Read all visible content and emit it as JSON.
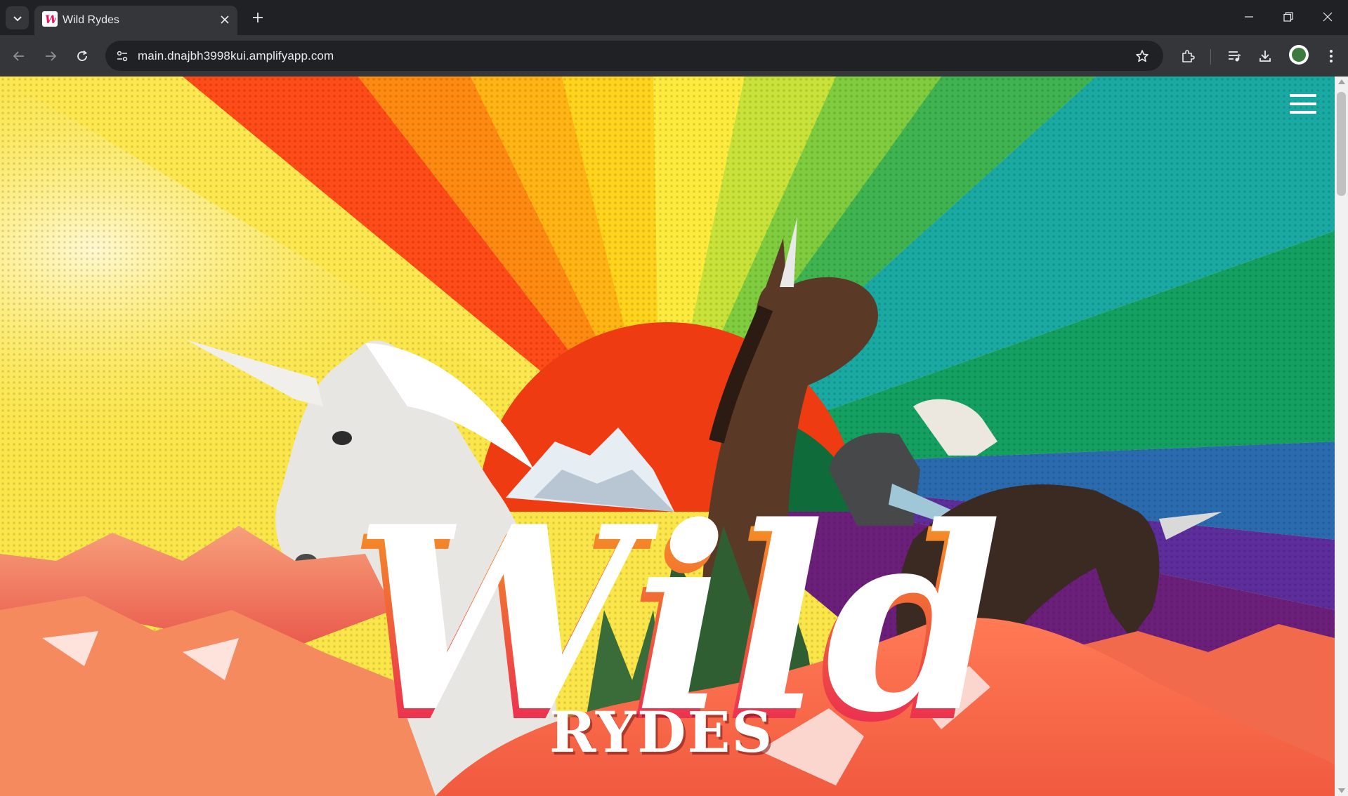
{
  "browser": {
    "tab_title": "Wild Rydes",
    "url": "main.dnajbh3998kui.amplifyapp.com"
  },
  "page": {
    "logo_main": "Wild",
    "logo_sub": "RYDES"
  },
  "colors": {
    "chrome_dark": "#202124",
    "chrome_mid": "#35363a",
    "logo_gradient_top": "#f7a21b",
    "logo_gradient_bottom": "#e8175d"
  }
}
